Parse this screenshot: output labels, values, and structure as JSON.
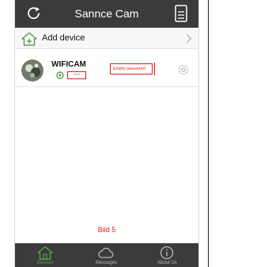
{
  "header": {
    "title": "Sannce Cam"
  },
  "add_row": {
    "label": "Add device"
  },
  "device": {
    "name": "WIFICAM",
    "status": "••••",
    "warning": "Empty password"
  },
  "caption": "Bild 5",
  "tabs": [
    {
      "label": "Devices",
      "icon": "home-icon",
      "active": true
    },
    {
      "label": "Messages",
      "icon": "cloud-icon",
      "active": false
    },
    {
      "label": "About Us",
      "icon": "info-icon",
      "active": false
    }
  ],
  "colors": {
    "header_bg": "#3b3b3b",
    "accent_green": "#55a04b",
    "alert_red": "#e31b1b"
  }
}
